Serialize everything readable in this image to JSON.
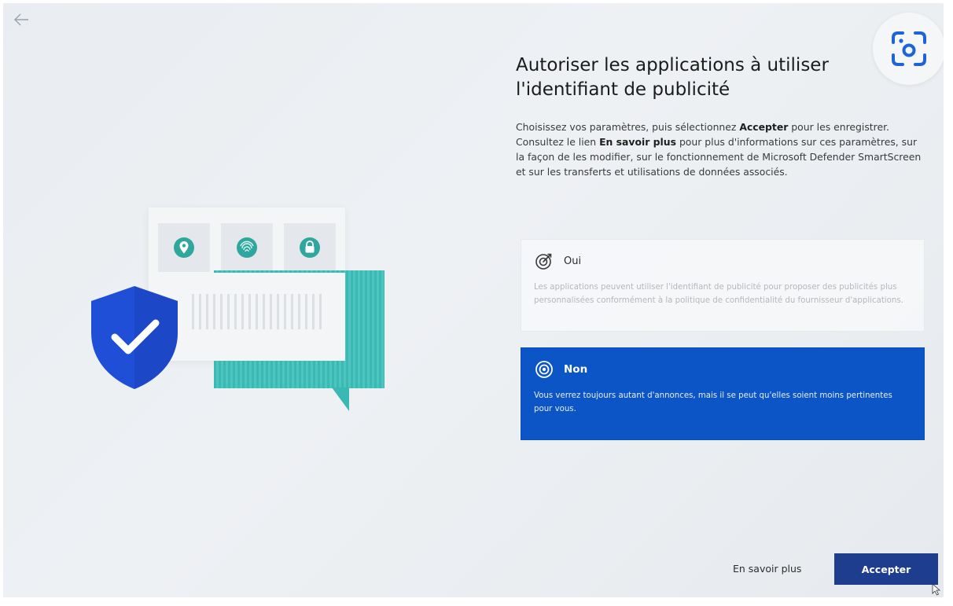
{
  "header": {
    "title": "Autoriser les applications à utiliser l'identifiant de publicité"
  },
  "description": {
    "part1": "Choisissez vos paramètres, puis sélectionnez ",
    "accept_word": "Accepter",
    "part2": " pour les enregistrer. Consultez le lien ",
    "learn_word": "En savoir plus",
    "part3": " pour plus d'informations sur ces paramètres, sur la façon de les modifier, sur le fonctionnement de Microsoft Defender SmartScreen et sur les transferts et utilisations de données associés."
  },
  "options": [
    {
      "label": "Oui",
      "text": "Les applications peuvent utiliser l'identifiant de publicité pour proposer des publicités plus personnalisées conformément à la politique de confidentialité du fournisseur d'applications.",
      "selected": false
    },
    {
      "label": "Non",
      "text": "Vous verrez toujours autant d'annonces, mais il se peut qu'elles soient moins pertinentes pour vous.",
      "selected": true
    }
  ],
  "footer": {
    "learn_more": "En savoir plus",
    "accept": "Accepter"
  },
  "icons": {
    "back": "arrow-left-icon",
    "lens": "visual-search-icon",
    "option_yes": "target-icon",
    "option_no": "radio-selected-icon"
  },
  "colors": {
    "selected_option": "#0b55c7",
    "accept_button": "#1e3d8f",
    "illustration_teal": "#3ab8b3",
    "shield_blue": "#1f4fd6"
  }
}
